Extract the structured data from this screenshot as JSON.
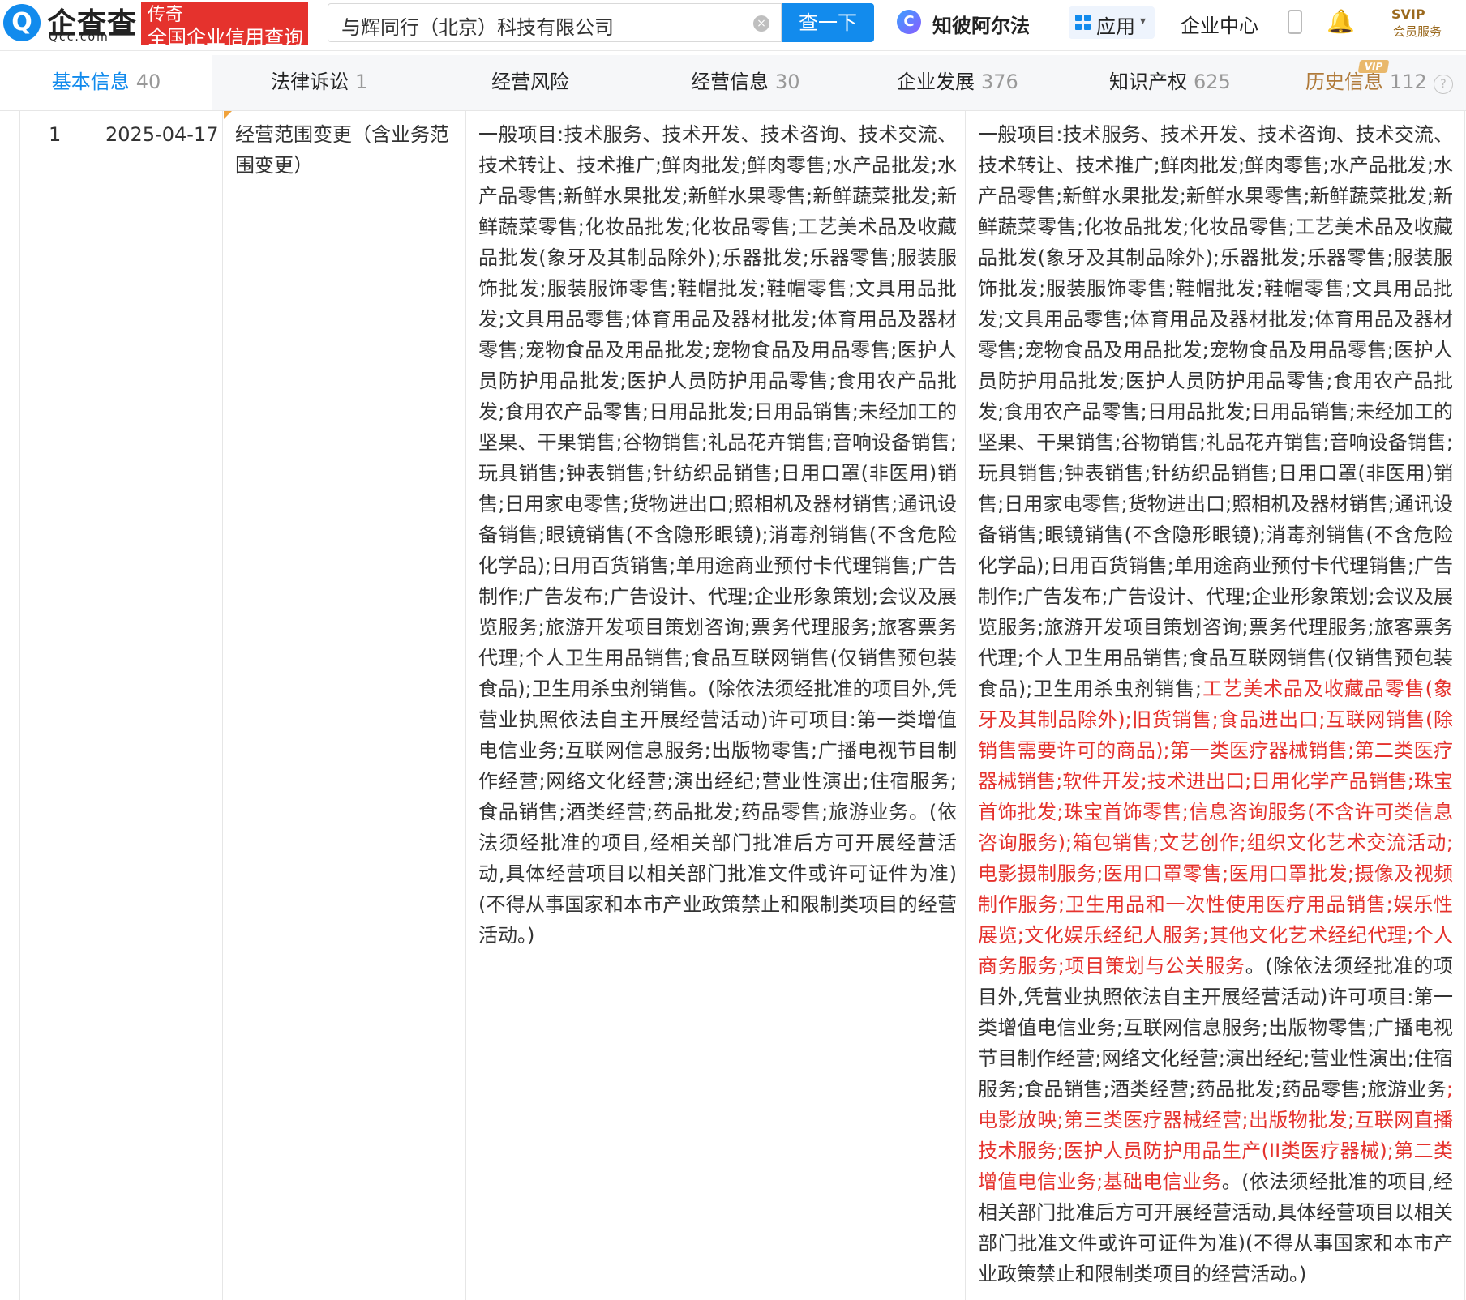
{
  "header": {
    "logo": {
      "mark": "Q",
      "name": "企查查",
      "domain": "Qcc.com",
      "badge_line1": "传奇",
      "badge_line2": "全国企业信用查询"
    },
    "search": {
      "value": "与辉同行（北京）科技有限公司",
      "clear_icon": "×",
      "button_label": "查一下"
    },
    "ai": {
      "mark": "C",
      "name": "知彼阿尔法"
    },
    "apps": {
      "label": "应用",
      "caret": "▾"
    },
    "enterprise_center": "企业中心",
    "bell_icon": "🔔",
    "svip": {
      "top": "SVIP",
      "bottom": "会员服务"
    }
  },
  "tabs": [
    {
      "label": "基本信息",
      "count": "40",
      "active": true
    },
    {
      "label": "法律诉讼",
      "count": "1"
    },
    {
      "label": "经营风险",
      "count": ""
    },
    {
      "label": "经营信息",
      "count": "30"
    },
    {
      "label": "企业发展",
      "count": "376"
    },
    {
      "label": "知识产权",
      "count": "625"
    },
    {
      "label": "历史信息",
      "count": "112",
      "vip": "VIP"
    }
  ],
  "info_icon": "?",
  "accent_color": "#128bed",
  "highlight_color": "#e5322d",
  "table": {
    "row": {
      "index": "1",
      "date": "2025-04-17",
      "change_type": "经营范围变更（含业务范围变更）",
      "before": "一般项目:技术服务、技术开发、技术咨询、技术交流、技术转让、技术推广;鲜肉批发;鲜肉零售;水产品批发;水产品零售;新鲜水果批发;新鲜水果零售;新鲜蔬菜批发;新鲜蔬菜零售;化妆品批发;化妆品零售;工艺美术品及收藏品批发(象牙及其制品除外);乐器批发;乐器零售;服装服饰批发;服装服饰零售;鞋帽批发;鞋帽零售;文具用品批发;文具用品零售;体育用品及器材批发;体育用品及器材零售;宠物食品及用品批发;宠物食品及用品零售;医护人员防护用品批发;医护人员防护用品零售;食用农产品批发;食用农产品零售;日用品批发;日用品销售;未经加工的坚果、干果销售;谷物销售;礼品花卉销售;音响设备销售;玩具销售;钟表销售;针纺织品销售;日用口罩(非医用)销售;日用家电零售;货物进出口;照相机及器材销售;通讯设备销售;眼镜销售(不含隐形眼镜);消毒剂销售(不含危险化学品);日用百货销售;单用途商业预付卡代理销售;广告制作;广告发布;广告设计、代理;企业形象策划;会议及展览服务;旅游开发项目策划咨询;票务代理服务;旅客票务代理;个人卫生用品销售;食品互联网销售(仅销售预包装食品);卫生用杀虫剂销售。(除依法须经批准的项目外,凭营业执照依法自主开展经营活动)许可项目:第一类增值电信业务;互联网信息服务;出版物零售;广播电视节目制作经营;网络文化经营;演出经纪;营业性演出;住宿服务;食品销售;酒类经营;药品批发;药品零售;旅游业务。(依法须经批准的项目,经相关部门批准后方可开展经营活动,具体经营项目以相关部门批准文件或许可证件为准)(不得从事国家和本市产业政策禁止和限制类项目的经营活动。)",
      "after_parts": [
        {
          "text": "一般项目:技术服务、技术开发、技术咨询、技术交流、技术转让、技术推广;鲜肉批发;鲜肉零售;水产品批发;水产品零售;新鲜水果批发;新鲜水果零售;新鲜蔬菜批发;新鲜蔬菜零售;化妆品批发;化妆品零售;工艺美术品及收藏品批发(象牙及其制品除外);乐器批发;乐器零售;服装服饰批发;服装服饰零售;鞋帽批发;鞋帽零售;文具用品批发;文具用品零售;体育用品及器材批发;体育用品及器材零售;宠物食品及用品批发;宠物食品及用品零售;医护人员防护用品批发;医护人员防护用品零售;食用农产品批发;食用农产品零售;日用品批发;日用品销售;未经加工的坚果、干果销售;谷物销售;礼品花卉销售;音响设备销售;玩具销售;钟表销售;针纺织品销售;日用口罩(非医用)销售;日用家电零售;货物进出口;照相机及器材销售;通讯设备销售;眼镜销售(不含隐形眼镜);消毒剂销售(不含危险化学品);日用百货销售;单用途商业预付卡代理销售;广告制作;广告发布;广告设计、代理;企业形象策划;会议及展览服务;旅游开发项目策划咨询;票务代理服务;旅客票务代理;个人卫生用品销售;食品互联网销售(仅销售预包装食品);卫生用杀虫剂销售;"
        },
        {
          "text": "工艺美术品及收藏品零售(象牙及其制品除外);旧货销售;食品进出口;互联网销售(除销售需要许可的商品);第一类医疗器械销售;第二类医疗器械销售;软件开发;技术进出口;日用化学产品销售;珠宝首饰批发;珠宝首饰零售;信息咨询服务(不含许可类信息咨询服务);箱包销售;文艺创作;组织文化艺术交流活动;电影摄制服务;医用口罩零售;医用口罩批发;摄像及视频制作服务;卫生用品和一次性使用医疗用品销售;娱乐性展览;文化娱乐经纪人服务;其他文化艺术经纪代理;个人商务服务;项目策划与公关服务",
          "highlight": true
        },
        {
          "text": "。(除依法须经批准的项目外,凭营业执照依法自主开展经营活动)许可项目:第一类增值电信业务;互联网信息服务;出版物零售;广播电视节目制作经营;网络文化经营;演出经纪;营业性演出;住宿服务;食品销售;酒类经营;药品批发;药品零售;旅游业务"
        },
        {
          "text": ";电影放映;第三类医疗器械经营;出版物批发;互联网直播技术服务;医护人员防护用品生产(II类医疗器械);第二类增值电信业务;基础电信业务",
          "highlight": true
        },
        {
          "text": "。(依法须经批准的项目,经相关部门批准后方可开展经营活动,具体经营项目以相关部门批准文件或许可证件为准)(不得从事国家和本市产业政策禁止和限制类项目的经营活动。)"
        }
      ]
    }
  }
}
